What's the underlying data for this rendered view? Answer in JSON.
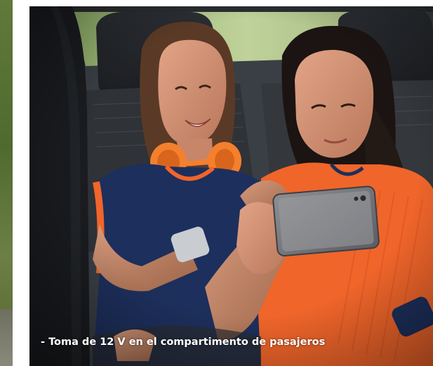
{
  "image": {
    "caption": "- Toma de 12 V en el compartimento de pasajeros"
  },
  "colors": {
    "headphones": "#f4802e",
    "jersey_orange": "#f0652a",
    "jersey_navy": "#1d2f5c",
    "caption_text": "#ffffff"
  },
  "icons": {
    "phone": "smartphone-icon",
    "headphones": "headphones-icon"
  }
}
